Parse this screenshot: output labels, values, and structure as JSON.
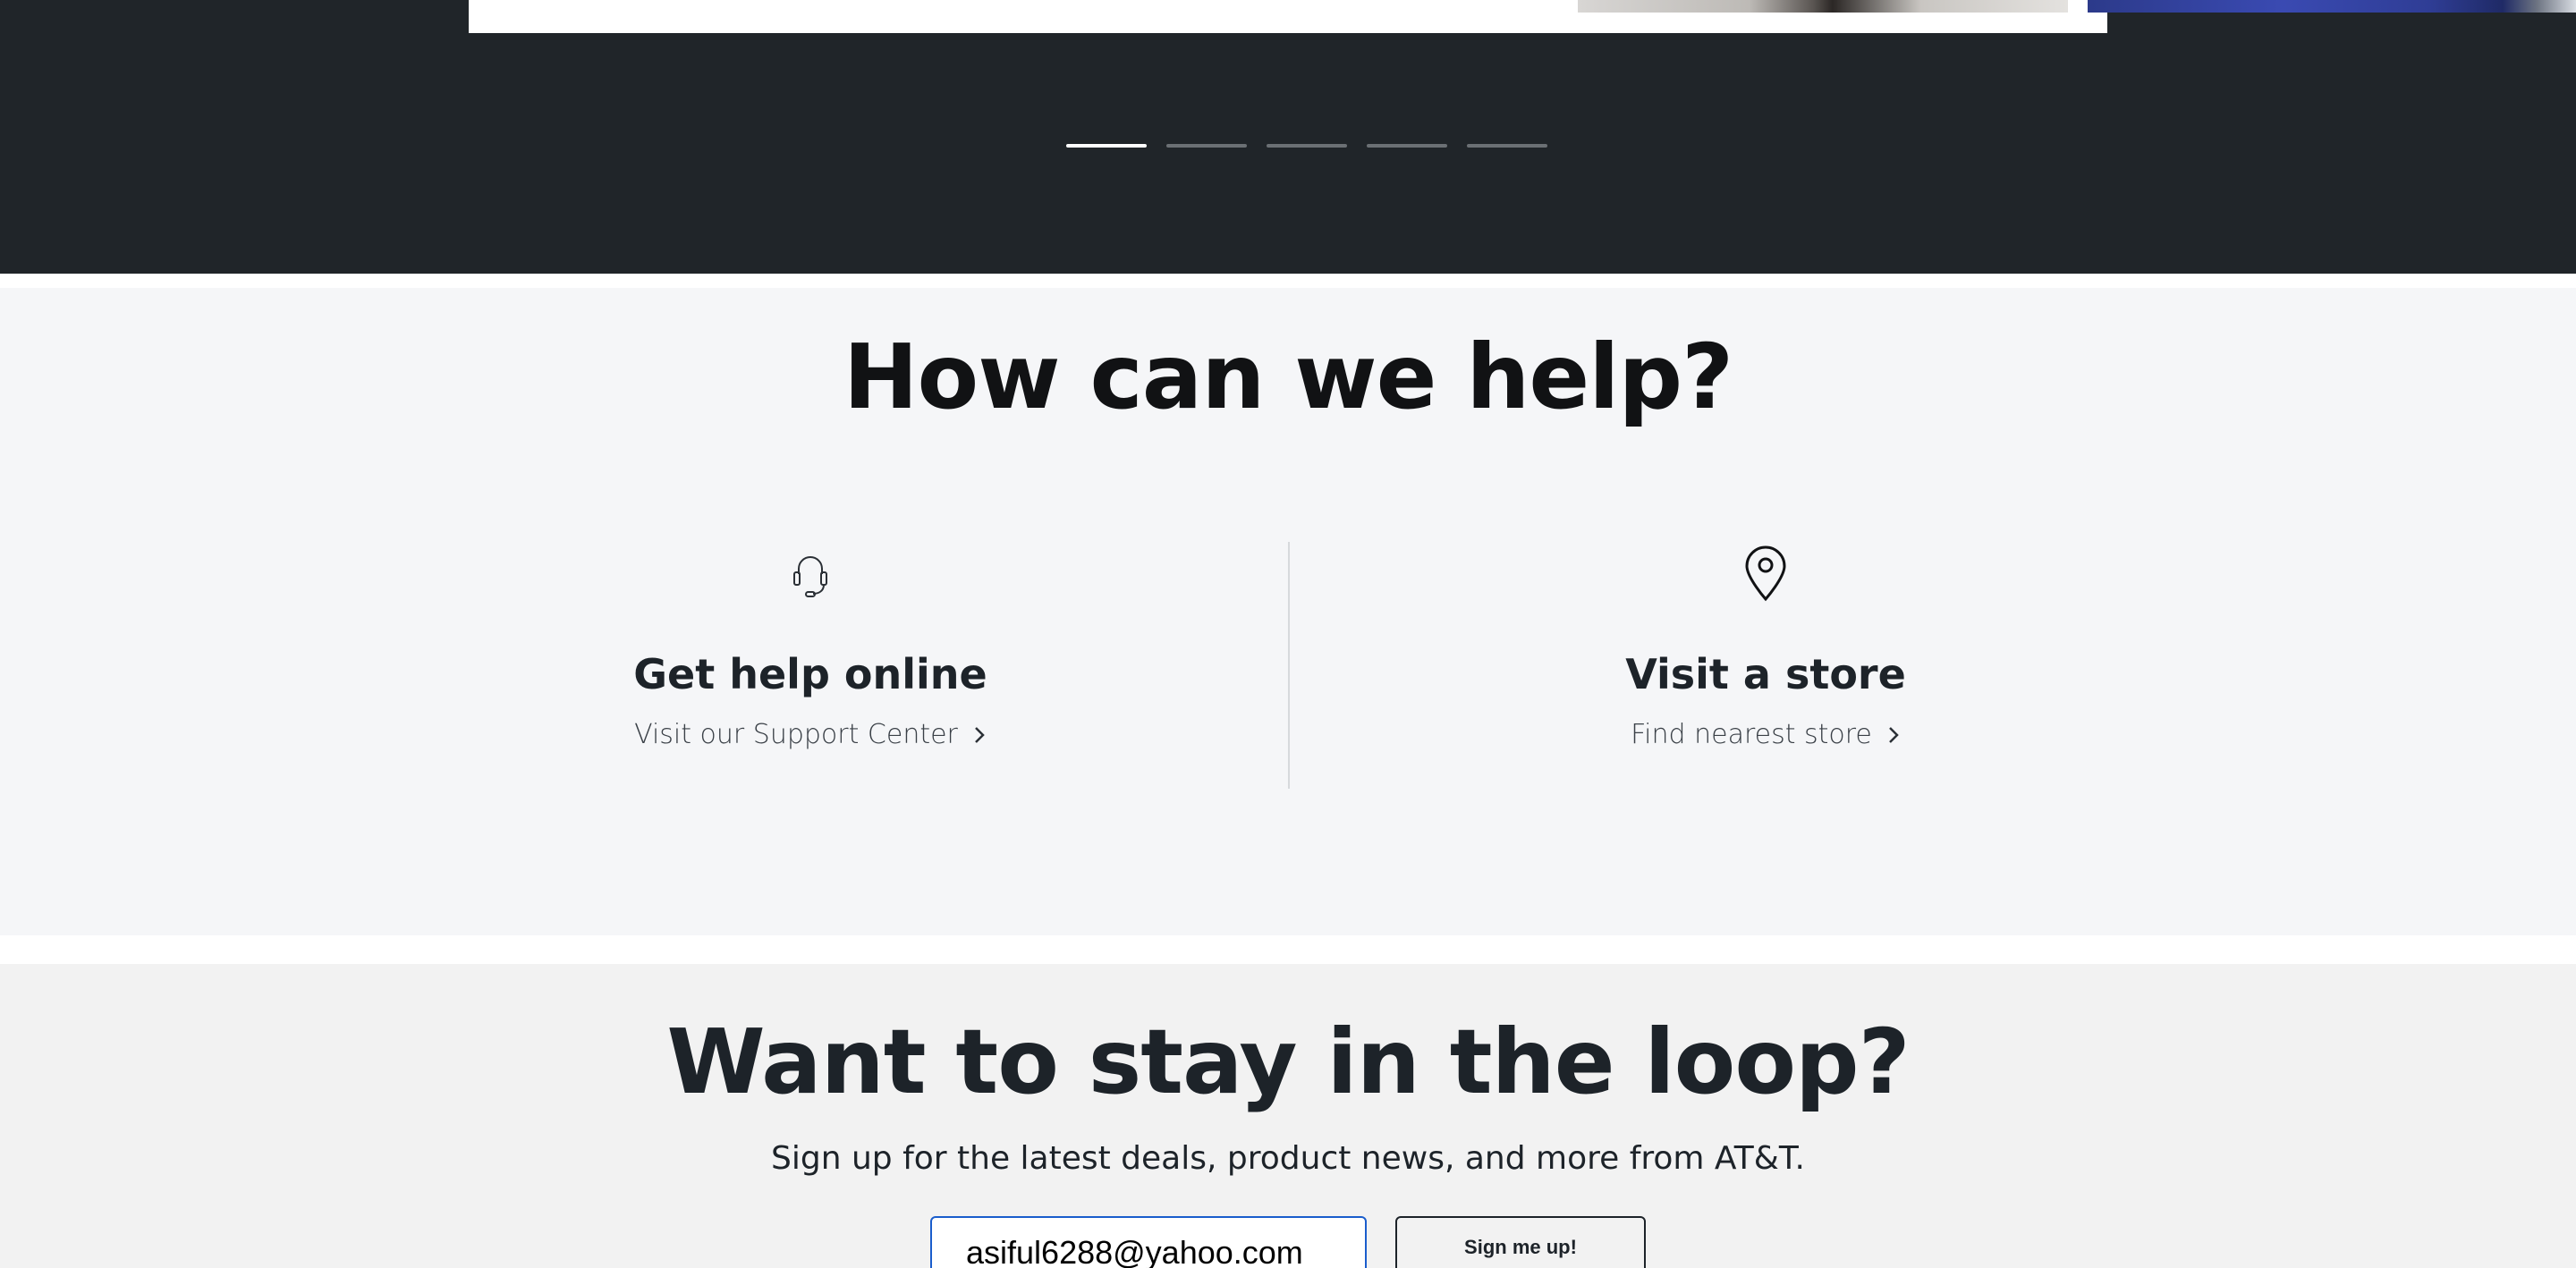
{
  "carousel": {
    "slide_count": 5,
    "active_index": 0
  },
  "help": {
    "title": "How can we help?",
    "online": {
      "icon": "headset-icon",
      "heading": "Get help online",
      "link": "Visit our Support Center"
    },
    "store": {
      "icon": "location-pin-icon",
      "heading": "Visit a store",
      "link": "Find nearest store"
    }
  },
  "newsletter": {
    "title": "Want to stay in the loop?",
    "subtitle": "Sign up for the latest deals, product news, and more from AT&T.",
    "email_value": "asiful6288@yahoo.com",
    "button_label": "Sign me up!"
  },
  "colors": {
    "dark_bg": "#202529",
    "help_bg": "#f5f6f8",
    "loop_bg": "#f2f2f2",
    "focus_border": "#1a5dcc"
  }
}
